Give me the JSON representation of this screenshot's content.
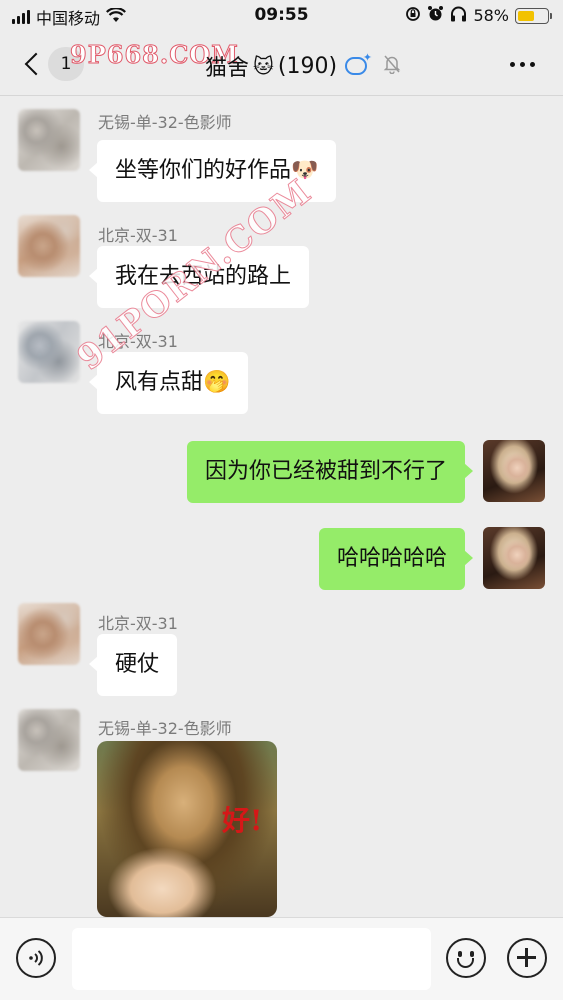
{
  "status_bar": {
    "carrier": "中国移动",
    "time": "09:55",
    "battery_percent": "58%",
    "battery_level": 0.58,
    "icons": [
      "signal-icon",
      "wifi-icon",
      "rotation-lock-icon",
      "alarm-icon",
      "headphones-icon",
      "battery-icon"
    ]
  },
  "header": {
    "back_icon": "chevron-left-icon",
    "unread_count": "1",
    "title": "猫舍",
    "title_emoji": "🐱",
    "member_count": "(190)",
    "more_icon": "ellipsis-icon"
  },
  "watermarks": {
    "top": "9P668.COM",
    "diagonal": "91PORN.COM"
  },
  "messages": [
    {
      "side": "left",
      "sender": "无锡-单-32-色影师",
      "text": "坐等你们的好作品",
      "emoji": "🐶"
    },
    {
      "side": "left",
      "sender": "北京-双-31",
      "text": "我在去西站的路上"
    },
    {
      "side": "left",
      "sender": "北京-双-31",
      "text": "风有点甜",
      "emoji": "🤭"
    },
    {
      "side": "right",
      "text": "因为你已经被甜到不行了"
    },
    {
      "side": "right",
      "text": "哈哈哈哈哈"
    },
    {
      "side": "left",
      "sender": "北京-双-31",
      "text": "硬仗"
    },
    {
      "side": "left",
      "sender": "无锡-单-32-色影师",
      "sticker_text": "好!"
    }
  ],
  "input_bar": {
    "placeholder": "",
    "icons": [
      "voice-icon",
      "emoji-icon",
      "plus-icon"
    ]
  },
  "colors": {
    "background": "#ededed",
    "outgoing_bubble": "#95ec69",
    "incoming_bubble": "#ffffff",
    "battery": "#f2c200"
  }
}
